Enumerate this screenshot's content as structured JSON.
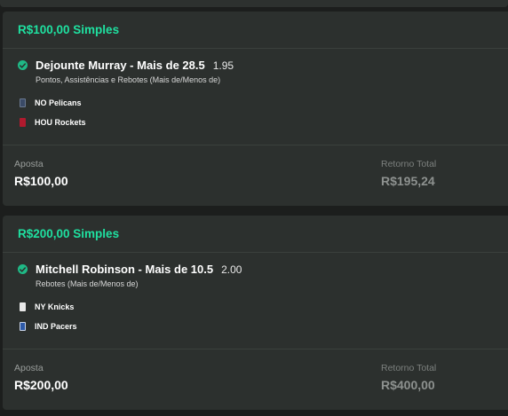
{
  "bets": [
    {
      "header": "R$100,00 Simples",
      "selection": {
        "title": "Dejounte Murray - Mais de 28.5",
        "odds": "1.95",
        "market": "Pontos, Assistências e Rebotes (Mais de/Menos de)",
        "teams": [
          {
            "name": "NO Pelicans",
            "color": "#3a4a66"
          },
          {
            "name": "HOU Rockets",
            "color": "#b01a2e"
          }
        ]
      },
      "stake_label": "Aposta",
      "stake_value": "R$100,00",
      "return_label": "Retorno Total",
      "return_value": "R$195,24"
    },
    {
      "header": "R$200,00 Simples",
      "selection": {
        "title": "Mitchell Robinson - Mais de 10.5",
        "odds": "2.00",
        "market": "Rebotes (Mais de/Menos de)",
        "teams": [
          {
            "name": "NY Knicks",
            "color": "#e8e8e8"
          },
          {
            "name": "IND Pacers",
            "color": "#2e5aa8"
          }
        ]
      },
      "stake_label": "Aposta",
      "stake_value": "R$200,00",
      "return_label": "Retorno Total",
      "return_value": "R$400,00"
    }
  ],
  "colors": {
    "accent": "#1fe0a0",
    "check": "#1fb986",
    "card_bg": "#2c302e",
    "page_bg": "#1c1e1d"
  }
}
